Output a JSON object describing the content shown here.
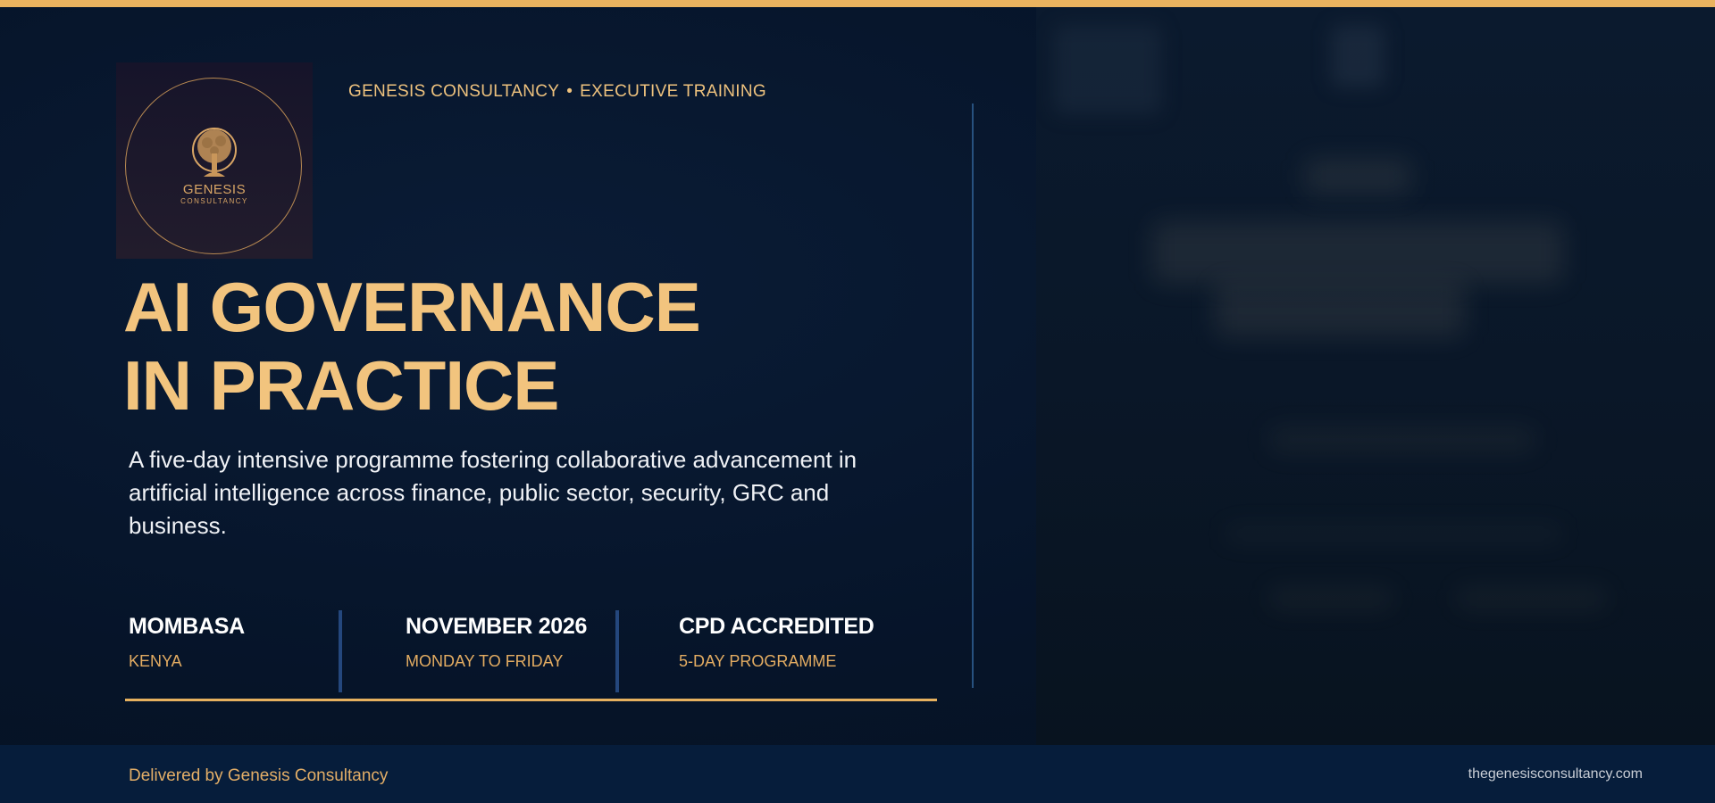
{
  "brand": {
    "logo_name": "GENESIS",
    "logo_sub": "CONSULTANCY",
    "eyebrow_left": "GENESIS CONSULTANCY",
    "eyebrow_sep": "•",
    "eyebrow_right": "EXECUTIVE TRAINING",
    "accent_color": "#f2c47e",
    "background_color": "#05152b"
  },
  "hero": {
    "title_line1": "AI GOVERNANCE",
    "title_line2": "IN PRACTICE",
    "subtitle": "A five-day intensive programme fostering collaborative advancement in artificial intelligence across finance, public sector, security, GRC and business."
  },
  "stats": [
    {
      "main": "MOMBASA",
      "sub": "KENYA"
    },
    {
      "main": "NOVEMBER 2026",
      "sub": "MONDAY TO FRIDAY"
    },
    {
      "main": "CPD ACCREDITED",
      "sub": "5-DAY PROGRAMME"
    }
  ],
  "footer": {
    "left": "Delivered by Genesis Consultancy",
    "right": "thegenesisconsultancy.com"
  },
  "icons": {
    "logo": "tree-icon"
  }
}
